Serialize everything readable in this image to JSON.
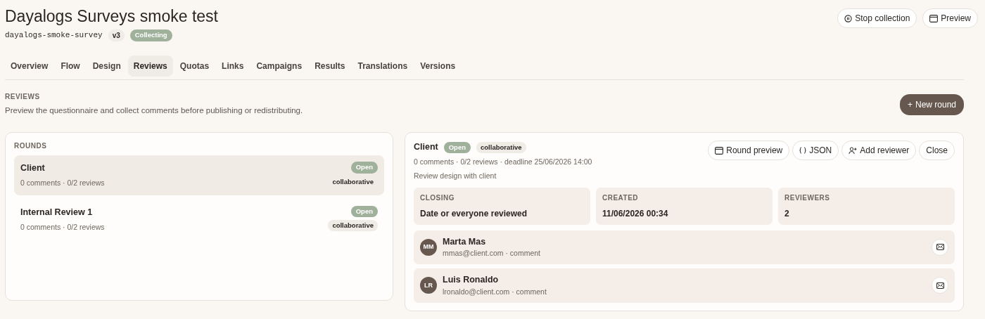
{
  "header": {
    "title": "Dayalogs Surveys smoke test",
    "slug": "dayalogs-smoke-survey",
    "version": "v3",
    "status": "Collecting"
  },
  "header_buttons": [
    {
      "kind": "stop",
      "label": "Stop collection"
    },
    {
      "kind": "preview",
      "label": "Preview"
    }
  ],
  "tabs": [
    {
      "label": "Overview",
      "selected": false
    },
    {
      "label": "Flow",
      "selected": false
    },
    {
      "label": "Design",
      "selected": false
    },
    {
      "label": "Reviews",
      "selected": true
    },
    {
      "label": "Quotas",
      "selected": false
    },
    {
      "label": "Links",
      "selected": false
    },
    {
      "label": "Campaigns",
      "selected": false
    },
    {
      "label": "Results",
      "selected": false
    },
    {
      "label": "Translations",
      "selected": false
    },
    {
      "label": "Versions",
      "selected": false
    }
  ],
  "section": {
    "heading": "REVIEWS",
    "description": "Preview the questionnaire and collect comments before publishing or redistributing.",
    "new_button": {
      "icon": "+",
      "label": "New round"
    }
  },
  "rounds": {
    "heading": "ROUNDS",
    "items": [
      {
        "name": "Client",
        "meta": "0 comments · 0/2 reviews",
        "status": "Open",
        "mode": "collaborative",
        "selected": true
      },
      {
        "name": "Internal Review 1",
        "meta": "0 comments · 0/2 reviews",
        "status": "Open",
        "mode": "collaborative",
        "selected": false
      }
    ]
  },
  "detail": {
    "name": "Client",
    "status": "Open",
    "mode": "collaborative",
    "meta": "0 comments · 0/2 reviews · deadline 25/06/2026 14:00",
    "description": "Review design with client",
    "buttons": [
      {
        "kind": "preview",
        "label": "Round preview"
      },
      {
        "kind": "json",
        "label": "JSON"
      },
      {
        "kind": "add-user",
        "label": "Add reviewer"
      },
      {
        "kind": "plain",
        "label": "Close"
      }
    ],
    "stats": [
      {
        "label": "CLOSING",
        "value": "Date or everyone reviewed"
      },
      {
        "label": "CREATED",
        "value": "11/06/2026 00:34"
      },
      {
        "label": "REVIEWERS",
        "value": "2"
      }
    ],
    "reviewers": [
      {
        "initials": "MM",
        "name": "Marta Mas",
        "meta": "mmas@client.com · comment"
      },
      {
        "initials": "LR",
        "name": "Luis Ronaldo",
        "meta": "lronaldo@client.com · comment"
      }
    ]
  }
}
